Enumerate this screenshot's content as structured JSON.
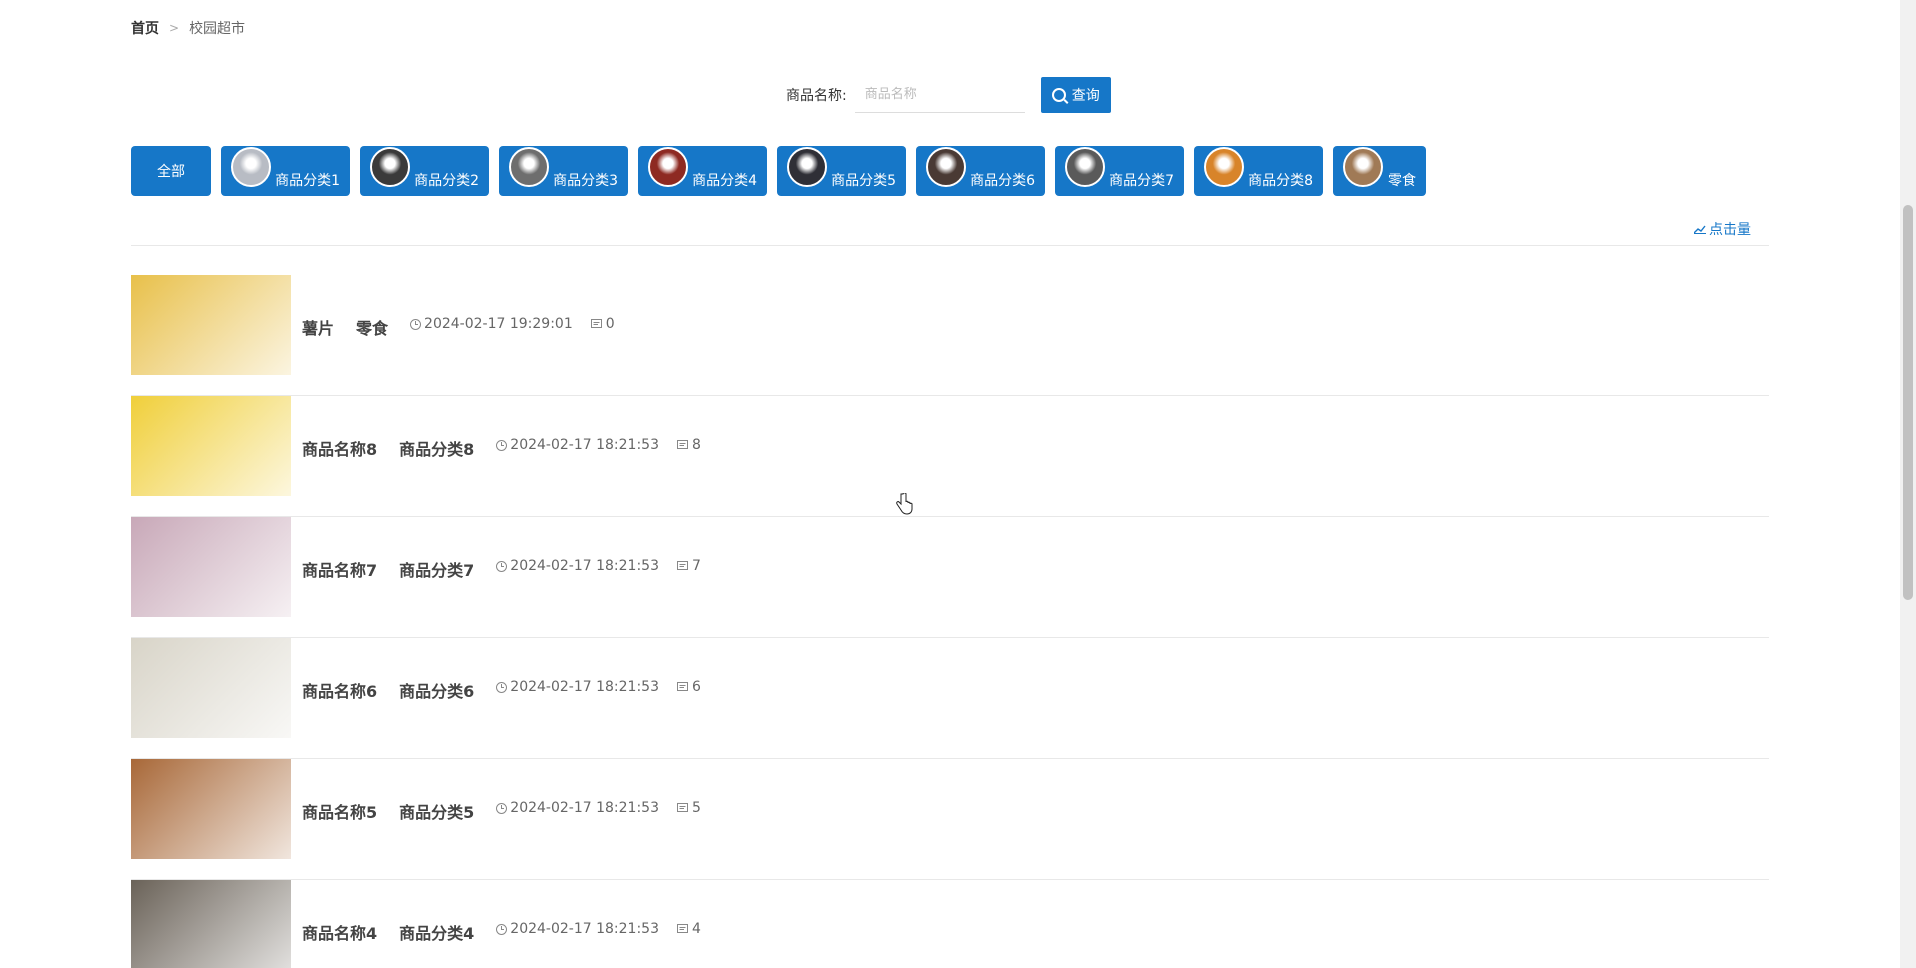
{
  "breadcrumb": {
    "home": "首页",
    "separator": ">",
    "current": "校园超市"
  },
  "search": {
    "label": "商品名称:",
    "placeholder": "商品名称",
    "value": "",
    "button_label": "查询"
  },
  "categories": [
    {
      "label": "全部",
      "thumb_color": "#1677c8"
    },
    {
      "label": "商品分类1",
      "thumb_color": "#b8bcc4"
    },
    {
      "label": "商品分类2",
      "thumb_color": "#3a3a3a"
    },
    {
      "label": "商品分类3",
      "thumb_color": "#6e6e6e"
    },
    {
      "label": "商品分类4",
      "thumb_color": "#8e2a22"
    },
    {
      "label": "商品分类5",
      "thumb_color": "#2f2f36"
    },
    {
      "label": "商品分类6",
      "thumb_color": "#4a3a34"
    },
    {
      "label": "商品分类7",
      "thumb_color": "#5a5a5a"
    },
    {
      "label": "商品分类8",
      "thumb_color": "#d8842a"
    },
    {
      "label": "零食",
      "thumb_color": "#a07a56"
    }
  ],
  "sort": {
    "label": "点击量"
  },
  "products": [
    {
      "name": "薯片",
      "category": "零食",
      "time": "2024-02-17 19:29:01",
      "count": "0",
      "image_color": "#e8c04a"
    },
    {
      "name": "商品名称8",
      "category": "商品分类8",
      "time": "2024-02-17 18:21:53",
      "count": "8",
      "image_color": "#f0cf3a"
    },
    {
      "name": "商品名称7",
      "category": "商品分类7",
      "time": "2024-02-17 18:21:53",
      "count": "7",
      "image_color": "#c8a8b8"
    },
    {
      "name": "商品名称6",
      "category": "商品分类6",
      "time": "2024-02-17 18:21:53",
      "count": "6",
      "image_color": "#d8d4c8"
    },
    {
      "name": "商品名称5",
      "category": "商品分类5",
      "time": "2024-02-17 18:21:53",
      "count": "5",
      "image_color": "#a86838"
    },
    {
      "name": "商品名称4",
      "category": "商品分类4",
      "time": "2024-02-17 18:21:53",
      "count": "4",
      "image_color": "#6a6258"
    }
  ],
  "colors": {
    "primary": "#1677c8",
    "divider": "#e8e8e8"
  }
}
